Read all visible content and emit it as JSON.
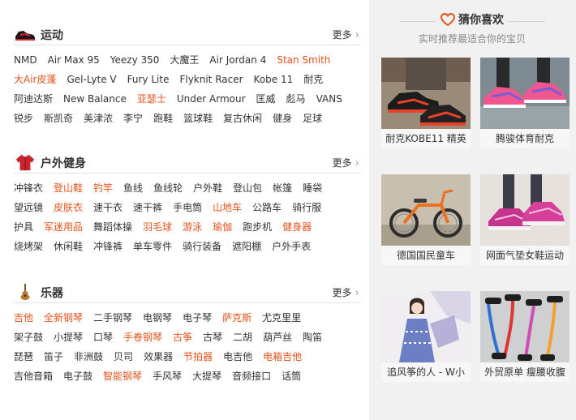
{
  "sections": [
    {
      "title": "运动",
      "more": "更多",
      "rows": [
        [
          {
            "t": "NMD",
            "hot": false
          },
          {
            "t": "Air Max 95",
            "hot": false
          },
          {
            "t": "Yeezy 350",
            "hot": false
          },
          {
            "t": "大魔王",
            "hot": false
          },
          {
            "t": "Air Jordan 4",
            "hot": false
          },
          {
            "t": "Stan Smith",
            "hot": true
          }
        ],
        [
          {
            "t": "大Air皮蓬",
            "hot": true
          },
          {
            "t": "Gel-Lyte V",
            "hot": false
          },
          {
            "t": "Fury Lite",
            "hot": false
          },
          {
            "t": "Flyknit Racer",
            "hot": false
          },
          {
            "t": "Kobe 11",
            "hot": false
          },
          {
            "t": "耐克",
            "hot": false
          }
        ],
        [
          {
            "t": "阿迪达斯",
            "hot": false
          },
          {
            "t": "New Balance",
            "hot": false
          },
          {
            "t": "亚瑟士",
            "hot": true
          },
          {
            "t": "Under Armour",
            "hot": false
          },
          {
            "t": "匡威",
            "hot": false
          },
          {
            "t": "彪马",
            "hot": false
          },
          {
            "t": "VANS",
            "hot": false
          }
        ],
        [
          {
            "t": "锐步",
            "hot": false
          },
          {
            "t": "斯凯奇",
            "hot": false
          },
          {
            "t": "美津浓",
            "hot": false
          },
          {
            "t": "李宁",
            "hot": false
          },
          {
            "t": "跑鞋",
            "hot": false
          },
          {
            "t": "篮球鞋",
            "hot": false
          },
          {
            "t": "复古休闲",
            "hot": false
          },
          {
            "t": "健身",
            "hot": false
          },
          {
            "t": "足球",
            "hot": false
          }
        ]
      ]
    },
    {
      "title": "户外健身",
      "more": "更多",
      "rows": [
        [
          {
            "t": "冲锋衣",
            "hot": false
          },
          {
            "t": "登山鞋",
            "hot": true
          },
          {
            "t": "钓竿",
            "hot": true
          },
          {
            "t": "鱼线",
            "hot": false
          },
          {
            "t": "鱼线轮",
            "hot": false
          },
          {
            "t": "户外鞋",
            "hot": false
          },
          {
            "t": "登山包",
            "hot": false
          },
          {
            "t": "帐篷",
            "hot": false
          },
          {
            "t": "睡袋",
            "hot": false
          }
        ],
        [
          {
            "t": "望远镜",
            "hot": false
          },
          {
            "t": "皮肤衣",
            "hot": true
          },
          {
            "t": "速干衣",
            "hot": false
          },
          {
            "t": "速干裤",
            "hot": false
          },
          {
            "t": "手电筒",
            "hot": false
          },
          {
            "t": "山地车",
            "hot": true
          },
          {
            "t": "公路车",
            "hot": false
          },
          {
            "t": "骑行服",
            "hot": false
          }
        ],
        [
          {
            "t": "护具",
            "hot": false
          },
          {
            "t": "军迷用品",
            "hot": true
          },
          {
            "t": "舞蹈体操",
            "hot": false
          },
          {
            "t": "羽毛球",
            "hot": true
          },
          {
            "t": "游泳",
            "hot": true
          },
          {
            "t": "瑜伽",
            "hot": true
          },
          {
            "t": "跑步机",
            "hot": false
          },
          {
            "t": "健身器",
            "hot": true
          }
        ],
        [
          {
            "t": "烧烤架",
            "hot": false
          },
          {
            "t": "休闲鞋",
            "hot": false
          },
          {
            "t": "冲锋裤",
            "hot": false
          },
          {
            "t": "单车零件",
            "hot": false
          },
          {
            "t": "骑行装备",
            "hot": false
          },
          {
            "t": "遮阳棚",
            "hot": false
          },
          {
            "t": "户外手表",
            "hot": false
          }
        ]
      ]
    },
    {
      "title": "乐器",
      "more": "更多",
      "rows": [
        [
          {
            "t": "吉他",
            "hot": true
          },
          {
            "t": "全新钢琴",
            "hot": true
          },
          {
            "t": "二手钢琴",
            "hot": false
          },
          {
            "t": "电钢琴",
            "hot": false
          },
          {
            "t": "电子琴",
            "hot": false
          },
          {
            "t": "萨克斯",
            "hot": true
          },
          {
            "t": "尤克里里",
            "hot": false
          }
        ],
        [
          {
            "t": "架子鼓",
            "hot": false
          },
          {
            "t": "小提琴",
            "hot": false
          },
          {
            "t": "口琴",
            "hot": false
          },
          {
            "t": "手卷钢琴",
            "hot": true
          },
          {
            "t": "古筝",
            "hot": true
          },
          {
            "t": "古琴",
            "hot": false
          },
          {
            "t": "二胡",
            "hot": false
          },
          {
            "t": "葫芦丝",
            "hot": false
          },
          {
            "t": "陶笛",
            "hot": false
          }
        ],
        [
          {
            "t": "琵琶",
            "hot": false
          },
          {
            "t": "笛子",
            "hot": false
          },
          {
            "t": "非洲鼓",
            "hot": false
          },
          {
            "t": "贝司",
            "hot": false
          },
          {
            "t": "效果器",
            "hot": false
          },
          {
            "t": "节拍器",
            "hot": true
          },
          {
            "t": "电吉他",
            "hot": false
          },
          {
            "t": "电箱吉他",
            "hot": true
          }
        ],
        [
          {
            "t": "吉他音箱",
            "hot": false
          },
          {
            "t": "电子鼓",
            "hot": false
          },
          {
            "t": "智能钢琴",
            "hot": true
          },
          {
            "t": "手风琴",
            "hot": false
          },
          {
            "t": "大提琴",
            "hot": false
          },
          {
            "t": "音频接口",
            "hot": false
          },
          {
            "t": "话筒",
            "hot": false
          }
        ]
      ]
    }
  ],
  "guess": {
    "title": "猜你喜欢",
    "subtitle": "实时推荐最适合你的宝贝",
    "items": [
      {
        "caption": "耐克KOBE11 精英"
      },
      {
        "caption": "腾骏体育耐克"
      },
      {
        "caption": "德国国民童车"
      },
      {
        "caption": "网面气垫女鞋运动"
      },
      {
        "caption": "追风筝的人 - W小"
      },
      {
        "caption": "外贸原单 瘦腰收腹"
      }
    ]
  },
  "colors": {
    "hot": "#e4521a",
    "heart": "#e4521a",
    "panel": "#f1f1f1"
  }
}
